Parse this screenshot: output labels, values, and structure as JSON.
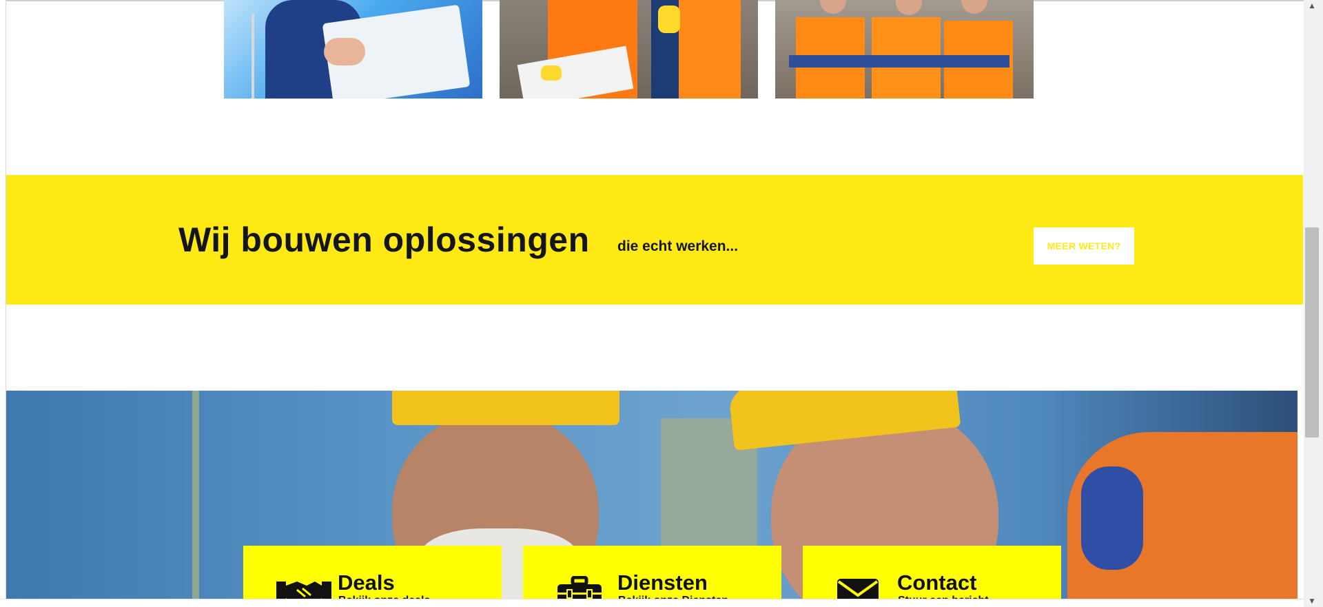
{
  "banner": {
    "title": "Wij bouwen oplossingen",
    "subtitle": "die echt werken...",
    "button_label": "MEER WETEN?"
  },
  "photos": [
    {
      "icon": "businessman-blueprint-photo"
    },
    {
      "icon": "workers-reviewing-plans-photo"
    },
    {
      "icon": "workers-arms-crossed-photo"
    }
  ],
  "hero": {
    "icon": "smiling-construction-workers-photo"
  },
  "cards": [
    {
      "title": "Deals",
      "subtitle": "Bekijk onze deals",
      "icon": "handshake-icon"
    },
    {
      "title": "Diensten",
      "subtitle": "Bekijk onze Diensten",
      "icon": "toolbox-icon"
    },
    {
      "title": "Contact",
      "subtitle": "Stuur een bericht",
      "icon": "envelope-icon"
    }
  ],
  "colors": {
    "banner_yellow": "#ffea15",
    "card_yellow": "#ffff00",
    "text_dark": "#151515",
    "button_white": "#ffffff"
  }
}
